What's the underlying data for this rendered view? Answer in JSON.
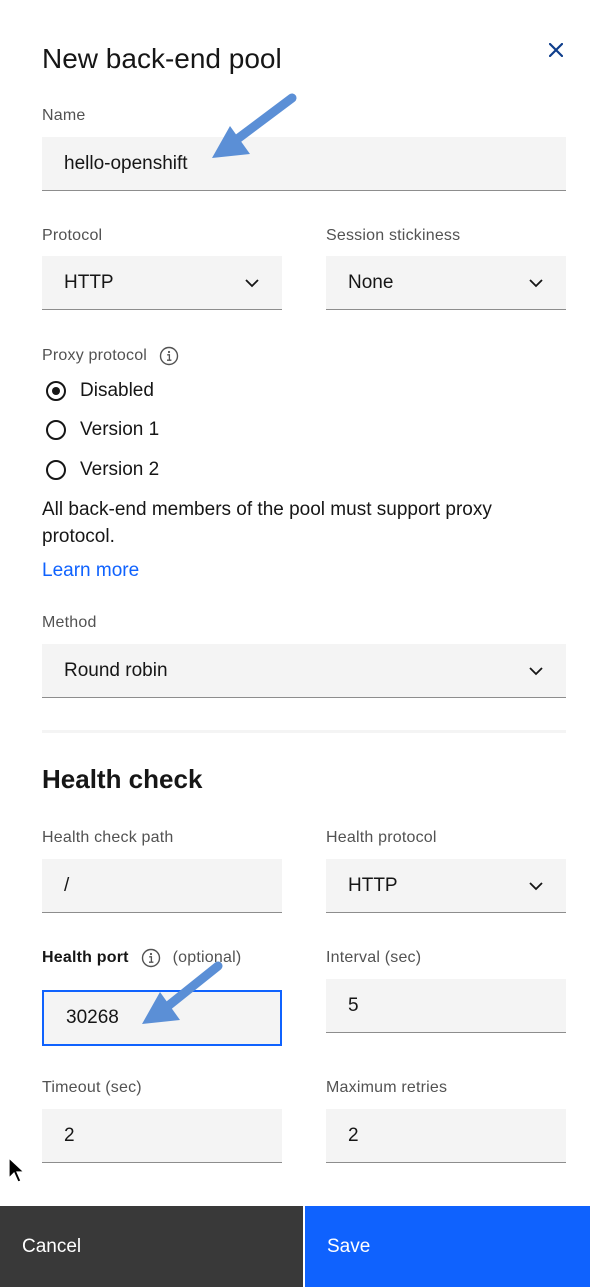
{
  "panel": {
    "title": "New back-end pool"
  },
  "name_field": {
    "label": "Name",
    "value": "hello-openshift"
  },
  "protocol": {
    "label": "Protocol",
    "value": "HTTP"
  },
  "session_stickiness": {
    "label": "Session stickiness",
    "value": "None"
  },
  "proxy_protocol": {
    "label": "Proxy protocol",
    "options": [
      "Disabled",
      "Version 1",
      "Version 2"
    ],
    "selected": "Disabled",
    "helper": "All back-end members of the pool must support proxy protocol.",
    "learn_more": "Learn more"
  },
  "method": {
    "label": "Method",
    "value": "Round robin"
  },
  "health_check": {
    "heading": "Health check",
    "path_label": "Health check path",
    "path_value": "/",
    "protocol_label": "Health protocol",
    "protocol_value": "HTTP",
    "port_label": "Health port",
    "port_optional": "(optional)",
    "port_value": "30268",
    "interval_label": "Interval (sec)",
    "interval_value": "5",
    "timeout_label": "Timeout (sec)",
    "timeout_value": "2",
    "retries_label": "Maximum retries",
    "retries_value": "2"
  },
  "footer": {
    "cancel": "Cancel",
    "save": "Save"
  },
  "colors": {
    "accent": "#0f62fe",
    "arrow": "#5b8fd6",
    "field_bg": "#f4f4f4",
    "cancel_bg": "#393939"
  }
}
